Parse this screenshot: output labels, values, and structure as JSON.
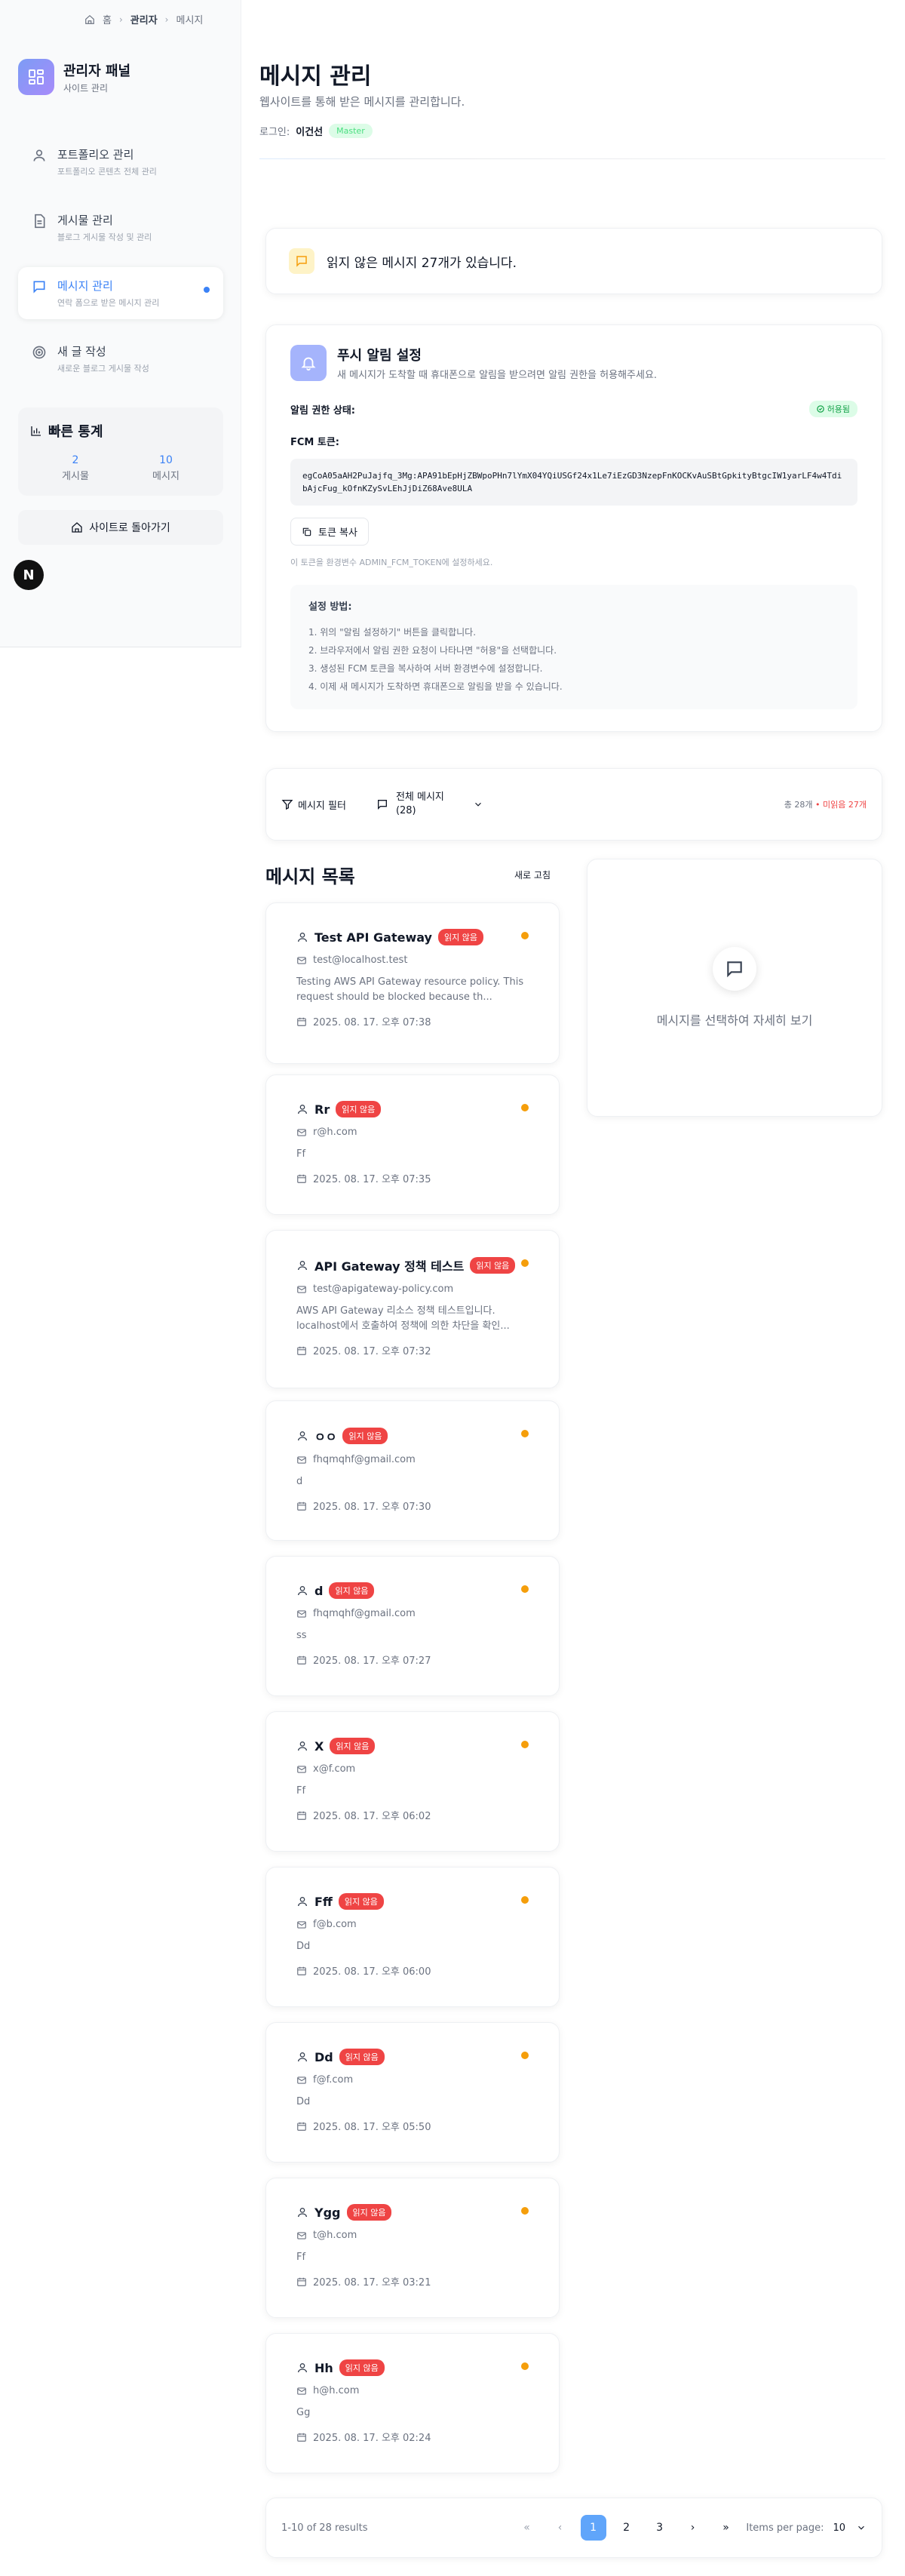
{
  "breadcrumb": {
    "home": "홈",
    "admin": "관리자",
    "current": "메시지"
  },
  "brand": {
    "title": "관리자 패널",
    "subtitle": "사이트 관리"
  },
  "nav": [
    {
      "label": "포트폴리오 관리",
      "desc": "포트폴리오 콘텐츠 전체 관리"
    },
    {
      "label": "게시물 관리",
      "desc": "블로그 게시물 작성 및 관리"
    },
    {
      "label": "메시지 관리",
      "desc": "연락 폼으로 받은 메시지 관리"
    },
    {
      "label": "새 글 작성",
      "desc": "새로운 블로그 게시물 작성"
    }
  ],
  "stats": {
    "title": "빠른 통계",
    "posts_count": "2",
    "posts_label": "게시물",
    "messages_count": "10",
    "messages_label": "메시지"
  },
  "back_label": "사이트로 돌아가기",
  "n_badge": "N",
  "header": {
    "title": "메시지 관리",
    "subtitle": "웹사이트를 통해 받은 메시지를 관리합니다.",
    "login_label": "로그인:",
    "login_name": "이건선",
    "role": "Master"
  },
  "unread_banner": "읽지 않은 메시지 27개가 있습니다.",
  "push": {
    "title": "푸시 알림 설정",
    "subtitle": "새 메시지가 도착할 때 휴대폰으로 알림을 받으려면 알림 권한을 허용해주세요.",
    "perm_label": "알림 권한 상태:",
    "perm_status": "허용됨",
    "fcm_label": "FCM 토큰:",
    "token": "egCoA05aAH2PuJajfq_3Mg:APA91bEpHjZBWpoPHn7lYmX04YQiUSGf24x1Le7iEzGD3NzepFnKOCKvAuSBtGpkityBtgcIW1yarLF4w4TdibAjcFug_kOfnKZySvLEhJjDiZ68Ave8ULA",
    "copy_label": "토큰 복사",
    "hint": "이 토큰을 환경변수 ADMIN_FCM_TOKEN에 설정하세요.",
    "setup_title": "설정 방법:",
    "steps": [
      "1. 위의 \"알림 설정하기\" 버튼을 클릭합니다.",
      "2. 브라우저에서 알림 권한 요청이 나타나면 \"허용\"을 선택합니다.",
      "3. 생성된 FCM 토큰을 복사하여 서버 환경변수에 설정합니다.",
      "4. 이제 새 메시지가 도착하면 휴대폰으로 알림을 받을 수 있습니다."
    ]
  },
  "filter": {
    "label": "메시지 필터",
    "select_line1": "전체 메시지",
    "select_line2": "(28)",
    "total": "총 28개",
    "unread": "• 미읽음 27개"
  },
  "list": {
    "title": "메시지 목록",
    "refresh": "새로 고침"
  },
  "messages": [
    {
      "name": "Test API Gateway",
      "badge": "읽지 않음",
      "email": "test@localhost.test",
      "body": "Testing AWS API Gateway resource policy. This request should be blocked because th...",
      "date": "2025. 08. 17. 오후 07:38"
    },
    {
      "name": "Rr",
      "badge": "읽지 않음",
      "email": "r@h.com",
      "body": "Ff",
      "date": "2025. 08. 17. 오후 07:35"
    },
    {
      "name": "API Gateway 정책 테스트",
      "badge": "읽지 않음",
      "email": "test@apigateway-policy.com",
      "body": "AWS API Gateway 리소스 정책 테스트입니다. localhost에서 호출하여 정책에 의한 차단을 확인...",
      "date": "2025. 08. 17. 오후 07:32"
    },
    {
      "name": "ㅇㅇ",
      "badge": "읽지 않음",
      "email": "fhqmqhf@gmail.com",
      "body": "d",
      "date": "2025. 08. 17. 오후 07:30"
    },
    {
      "name": "d",
      "badge": "읽지 않음",
      "email": "fhqmqhf@gmail.com",
      "body": "ss",
      "date": "2025. 08. 17. 오후 07:27"
    },
    {
      "name": "X",
      "badge": "읽지 않음",
      "email": "x@f.com",
      "body": "Ff",
      "date": "2025. 08. 17. 오후 06:02"
    },
    {
      "name": "Fff",
      "badge": "읽지 않음",
      "email": "f@b.com",
      "body": "Dd",
      "date": "2025. 08. 17. 오후 06:00"
    },
    {
      "name": "Dd",
      "badge": "읽지 않음",
      "email": "f@f.com",
      "body": "Dd",
      "date": "2025. 08. 17. 오후 05:50"
    },
    {
      "name": "Ygg",
      "badge": "읽지 않음",
      "email": "t@h.com",
      "body": "Ff",
      "date": "2025. 08. 17. 오후 03:21"
    },
    {
      "name": "Hh",
      "badge": "읽지 않음",
      "email": "h@h.com",
      "body": "Gg",
      "date": "2025. 08. 17. 오후 02:24"
    }
  ],
  "detail_placeholder": "메시지를 선택하여 자세히 보기",
  "pagination": {
    "results": "1-10 of 28 results",
    "first": "«",
    "prev": "‹",
    "next": "›",
    "last": "»",
    "pages": [
      "1",
      "2",
      "3"
    ],
    "per_page_label": "Items per page:",
    "per_page_value": "10"
  }
}
